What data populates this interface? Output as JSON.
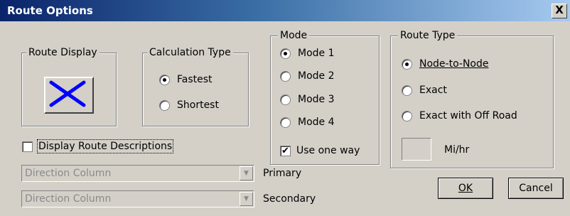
{
  "window": {
    "title": "Route Options",
    "close_label": "X"
  },
  "route_display": {
    "label": "Route Display",
    "icon": "x-mark-icon",
    "icon_color": "#0000ff"
  },
  "calculation_type": {
    "label": "Calculation Type",
    "options": [
      {
        "label": "Fastest",
        "selected": true
      },
      {
        "label": "Shortest",
        "selected": false
      }
    ]
  },
  "mode": {
    "label": "Mode",
    "options": [
      {
        "label": "Mode 1",
        "selected": true
      },
      {
        "label": "Mode 2",
        "selected": false
      },
      {
        "label": "Mode 3",
        "selected": false
      },
      {
        "label": "Mode 4",
        "selected": false
      }
    ],
    "use_one_way": {
      "label": "Use one way",
      "checked": true
    }
  },
  "route_type": {
    "label": "Route Type",
    "options": [
      {
        "label": "Node-to-Node",
        "selected": true
      },
      {
        "label": "Exact",
        "selected": false
      },
      {
        "label": "Exact with Off Road",
        "selected": false
      }
    ],
    "speed_unit": "Mi/hr"
  },
  "display_route_descriptions": {
    "label": "Display Route Descriptions",
    "checked": false
  },
  "primary_column": {
    "value": "Direction Column",
    "label": "Primary"
  },
  "secondary_column": {
    "value": "Direction Column",
    "label": "Secondary"
  },
  "buttons": {
    "ok": "OK",
    "cancel": "Cancel"
  }
}
